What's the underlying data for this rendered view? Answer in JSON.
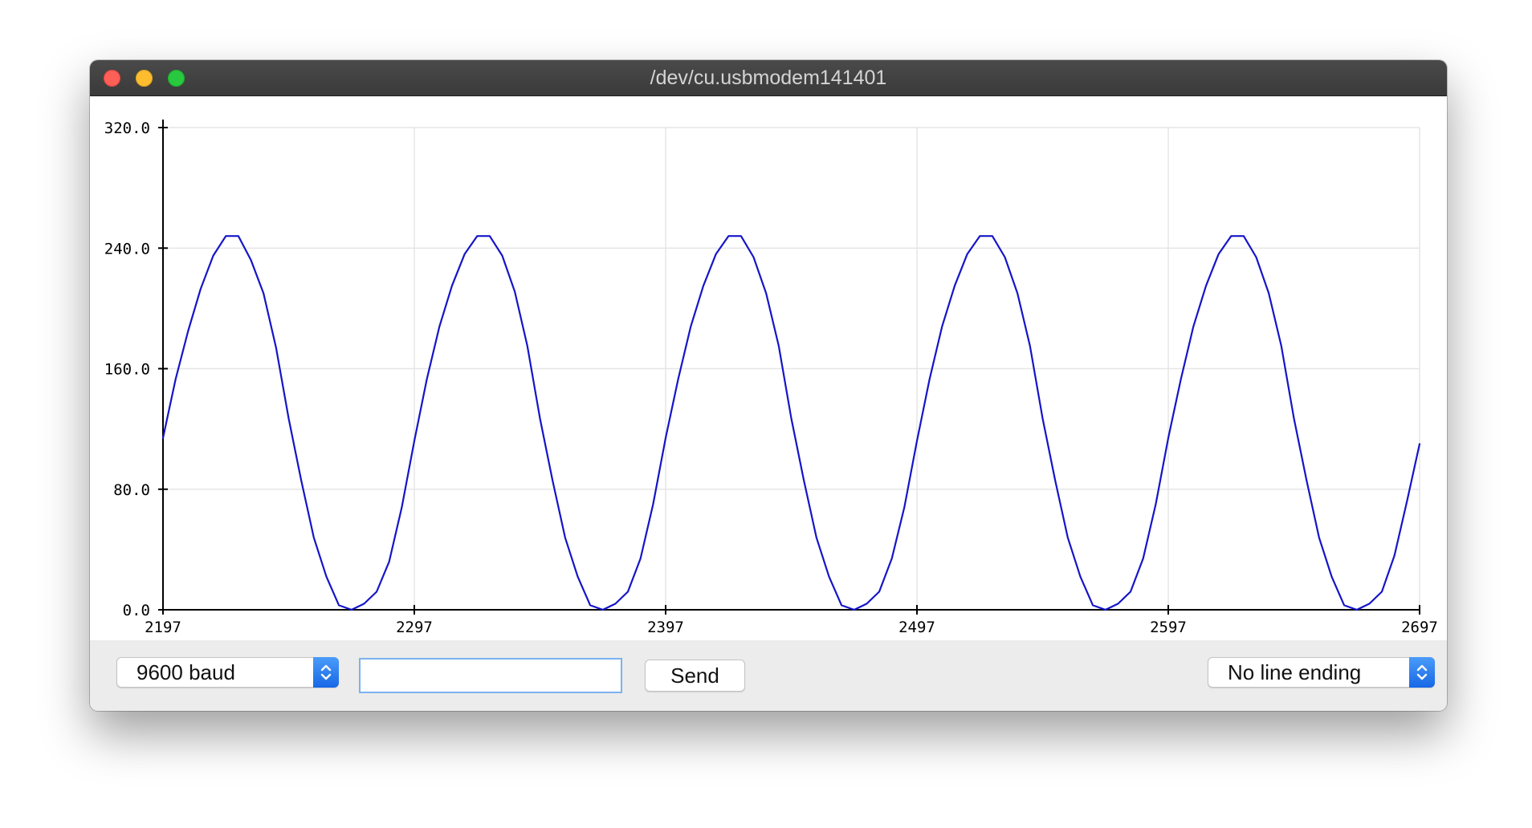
{
  "window": {
    "title": "/dev/cu.usbmodem141401"
  },
  "toolbar": {
    "baud_select": "9600 baud",
    "message_input_value": "",
    "send_label": "Send",
    "line_ending_select": "No line ending"
  },
  "colors": {
    "series": "#1515c8",
    "grid": "#e6e6e6",
    "accent": "#1867e6"
  },
  "chart_data": {
    "type": "line",
    "xlim": [
      2197,
      2697
    ],
    "ylim": [
      0,
      320
    ],
    "x_ticks": [
      "2197",
      "2297",
      "2397",
      "2497",
      "2597",
      "2697"
    ],
    "y_ticks": [
      "0.0",
      "80.0",
      "160.0",
      "240.0",
      "320.0"
    ],
    "grid": true,
    "legend": "none",
    "series": [
      {
        "x": [
          2197,
          2202,
          2207,
          2212,
          2217,
          2222,
          2227,
          2232,
          2237,
          2242,
          2247,
          2252,
          2257,
          2262,
          2267,
          2272,
          2277,
          2282,
          2287,
          2292,
          2297,
          2302,
          2307,
          2312,
          2317,
          2322,
          2327,
          2332,
          2337,
          2342,
          2347,
          2352,
          2357,
          2362,
          2367,
          2372,
          2377,
          2382,
          2387,
          2392,
          2397,
          2402,
          2407,
          2412,
          2417,
          2422,
          2427,
          2432,
          2437,
          2442,
          2447,
          2452,
          2457,
          2462,
          2467,
          2472,
          2477,
          2482,
          2487,
          2492,
          2497,
          2502,
          2507,
          2512,
          2517,
          2522,
          2527,
          2532,
          2537,
          2542,
          2547,
          2552,
          2557,
          2562,
          2567,
          2572,
          2577,
          2582,
          2587,
          2592,
          2597,
          2602,
          2607,
          2612,
          2617,
          2622,
          2627,
          2632,
          2637,
          2642,
          2647,
          2652,
          2657,
          2662,
          2667,
          2672,
          2677,
          2682,
          2687,
          2692,
          2697
        ],
        "values": [
          114,
          153,
          185,
          213,
          235,
          248,
          248,
          232,
          210,
          174,
          127,
          86,
          48,
          22,
          3,
          0,
          4,
          12,
          32,
          68,
          112,
          153,
          188,
          215,
          236,
          248,
          248,
          235,
          211,
          175,
          127,
          86,
          48,
          22,
          3,
          0,
          4,
          12,
          34,
          70,
          114,
          153,
          188,
          215,
          236,
          248,
          248,
          234,
          210,
          175,
          127,
          86,
          48,
          22,
          3,
          0,
          4,
          12,
          34,
          68,
          112,
          153,
          188,
          215,
          236,
          248,
          248,
          234,
          210,
          175,
          127,
          86,
          48,
          22,
          3,
          0,
          4,
          12,
          34,
          70,
          114,
          153,
          188,
          215,
          236,
          248,
          248,
          234,
          210,
          175,
          127,
          86,
          48,
          22,
          3,
          0,
          4,
          12,
          36,
          72,
          110
        ]
      }
    ]
  }
}
